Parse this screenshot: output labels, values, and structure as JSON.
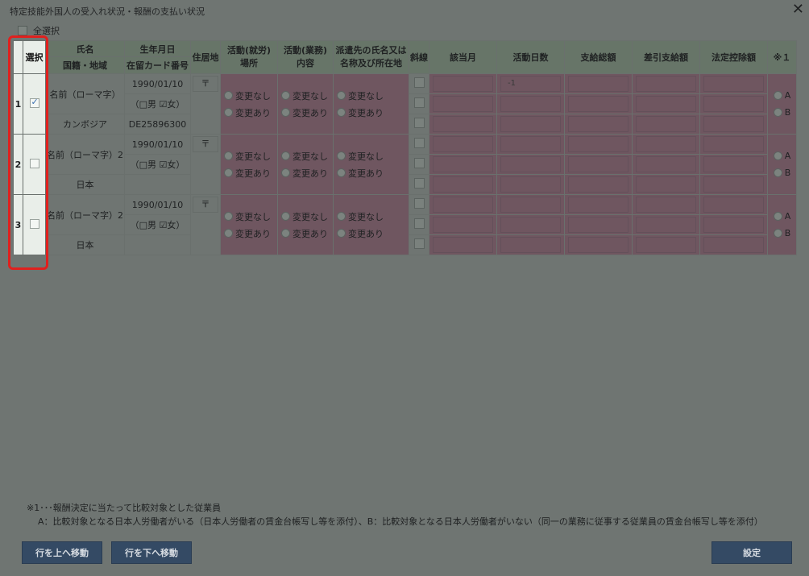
{
  "dialog": {
    "title": "特定技能外国人の受入れ状況・報酬の支払い状況",
    "close_icon": "✕",
    "select_all_label": "全選択"
  },
  "headers": {
    "select": "選択",
    "name": "氏名",
    "nationality": "国籍・地域",
    "birthdate": "生年月日",
    "card_no": "在留カード番号",
    "address": "住居地",
    "activity_place": "活動(就労)\n場所",
    "activity_content": "活動(業務)\n内容",
    "dispatch": "派遣先の氏名又は\n名称及び所在地",
    "strike": "斜線",
    "month": "該当月",
    "days": "活動日数",
    "pay_total": "支給総額",
    "net_pay": "差引支給額",
    "deduction": "法定控除額",
    "note1": "※１"
  },
  "rows": [
    {
      "no": "1",
      "checked": true,
      "name": "名前（ローマ字）",
      "birthdate": "1990/01/10",
      "gender": "（□男 ☑女）",
      "nationality": "カンボジア",
      "card_no": "DE25896300",
      "postal": "〒",
      "change_none": "変更なし",
      "change_yes": "変更あり",
      "days_first": "-1",
      "opt_a": "A",
      "opt_b": "B"
    },
    {
      "no": "2",
      "checked": false,
      "name": "名前（ローマ字）2",
      "birthdate": "1990/01/10",
      "gender": "（□男 ☑女）",
      "nationality": "日本",
      "card_no": "",
      "postal": "〒",
      "change_none": "変更なし",
      "change_yes": "変更あり",
      "days_first": "",
      "opt_a": "A",
      "opt_b": "B"
    },
    {
      "no": "3",
      "checked": false,
      "name": "名前（ローマ字）2",
      "birthdate": "1990/01/10",
      "gender": "（□男 ☑女）",
      "nationality": "日本",
      "card_no": "",
      "postal": "〒",
      "change_none": "変更なし",
      "change_yes": "変更あり",
      "days_first": "",
      "opt_a": "A",
      "opt_b": "B"
    }
  ],
  "footnote": {
    "line1": "※1･･･報酬決定に当たって比較対象とした従業員",
    "line2": "A：比較対象となる日本人労働者がいる（日本人労働者の賃金台帳写し等を添付）、B：比較対象となる日本人労働者がいない（同一の業務に従事する従業員の賃金台帳写し等を添付）"
  },
  "buttons": {
    "move_up": "行を上へ移動",
    "move_down": "行を下へ移動",
    "settings": "設定"
  },
  "colors": {
    "highlight": "#e0201e",
    "button_bg": "#344a64",
    "pink_cell": "#6f5660"
  }
}
